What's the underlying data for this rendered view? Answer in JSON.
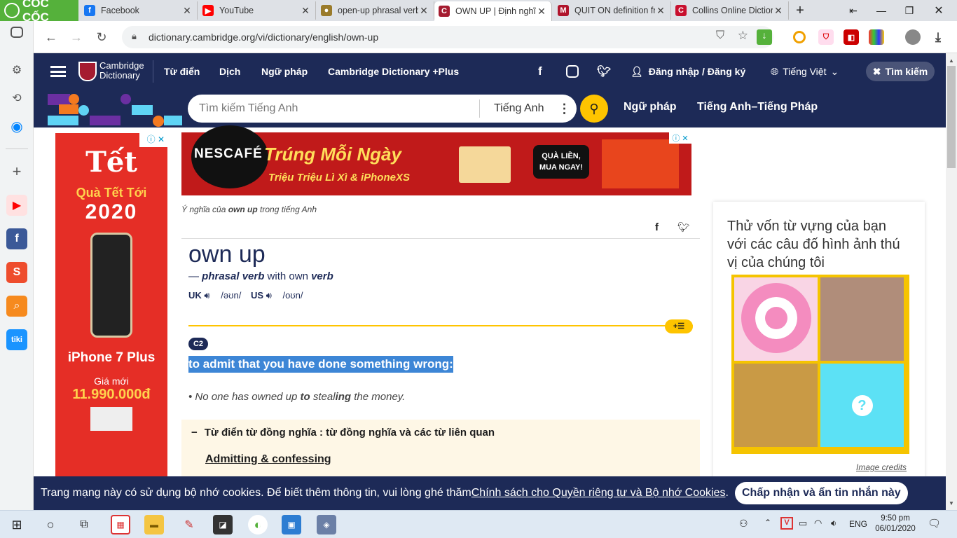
{
  "browser": {
    "brand": "CỐC CỐC",
    "tabs": [
      {
        "title": "Facebook",
        "icon": "facebook-icon",
        "color": "#1877f2",
        "glyph": "f"
      },
      {
        "title": "YouTube",
        "icon": "youtube-icon",
        "color": "#ff0000",
        "glyph": "▶"
      },
      {
        "title": "open-up phrasal verb",
        "icon": "openup-favicon",
        "color": "#9a7b2a",
        "glyph": "●"
      },
      {
        "title": "OWN UP | Định nghĩa",
        "icon": "cambridge-favicon",
        "color": "#a51c30",
        "glyph": "C"
      },
      {
        "title": "QUIT ON definition fr",
        "icon": "quiton-favicon",
        "color": "#b0152c",
        "glyph": "M"
      },
      {
        "title": "Collins Online Dictior",
        "icon": "collins-favicon",
        "color": "#c8102e",
        "glyph": "C"
      }
    ],
    "url": "dictionary.cambridge.org/vi/dictionary/english/own-up"
  },
  "sidebar": {
    "items": [
      "gear-icon",
      "history-icon",
      "messenger-icon",
      "add-icon",
      "youtube-icon",
      "facebook-icon",
      "shopee-icon",
      "search-icon",
      "tiki-icon"
    ]
  },
  "header": {
    "logo_line1": "Cambridge",
    "logo_line2": "Dictionary",
    "nav": [
      "Từ điển",
      "Dịch",
      "Ngữ pháp",
      "Cambridge Dictionary +Plus"
    ],
    "login": "Đăng nhập / Đăng ký",
    "language": "Tiếng Việt",
    "search_button": "Tìm kiếm"
  },
  "searchbar": {
    "placeholder": "Tìm kiếm Tiếng Anh",
    "dictionary": "Tiếng Anh",
    "link1": "Ngữ pháp",
    "link2": "Tiếng Anh–Tiếng Pháp"
  },
  "ad_left": {
    "title": "Tết",
    "line1": "Quà Tết Tới",
    "year": "2020",
    "model": "iPhone 7 Plus",
    "price_label": "Giá mới",
    "price": "11.990.000đ"
  },
  "ad_top": {
    "brand": "NESCAFÉ",
    "headline": "Trúng Mỗi Ngày",
    "subline": "Triệu Triệu Lì Xì & iPhoneXS",
    "cta": "QUÀ LIỀN, MUA NGAY!"
  },
  "entry": {
    "breadcrumb_pre": "Ý nghĩa của ",
    "breadcrumb_word": "own up",
    "breadcrumb_post": " trong tiếng Anh",
    "headword": "own up",
    "pos_dash": "— ",
    "pos": "phrasal verb",
    "pos_with": " with own ",
    "pos_verb": "verb",
    "uk_label": "UK",
    "uk_ipa": "/əʊn/",
    "us_label": "US",
    "us_ipa": "/oʊn/",
    "level": "C2",
    "definition": "to admit that you have done something wrong:",
    "example_pre": "No one has owned up ",
    "example_bold1": "to",
    "example_mid": " steal",
    "example_bold2": "ing",
    "example_post": " the money.",
    "thesaurus_title": "Từ điển từ đồng nghĩa : từ đồng nghĩa và các từ liên quan",
    "thesaurus_link": "Admitting & confessing"
  },
  "quiz": {
    "title": "Thử vốn từ vựng của bạn với các câu đố hình ảnh thú vị của chúng tôi",
    "credits": "Image credits"
  },
  "cookie": {
    "text": "Trang mạng này có sử dụng bộ nhớ cookies. Để biết thêm thông tin, vui lòng ghé thăm ",
    "link": "Chính sách cho Quyền riêng tư và Bộ nhớ Cookies",
    "text_end": ".",
    "button": "Chấp nhận và ẩn tin nhắn này"
  },
  "taskbar": {
    "lang": "ENG",
    "time": "9:50 pm",
    "date": "06/01/2020"
  },
  "colors": {
    "cambridge_navy": "#1d2a57",
    "cambridge_yellow": "#fec400",
    "coccoc_green": "#55b13b"
  }
}
